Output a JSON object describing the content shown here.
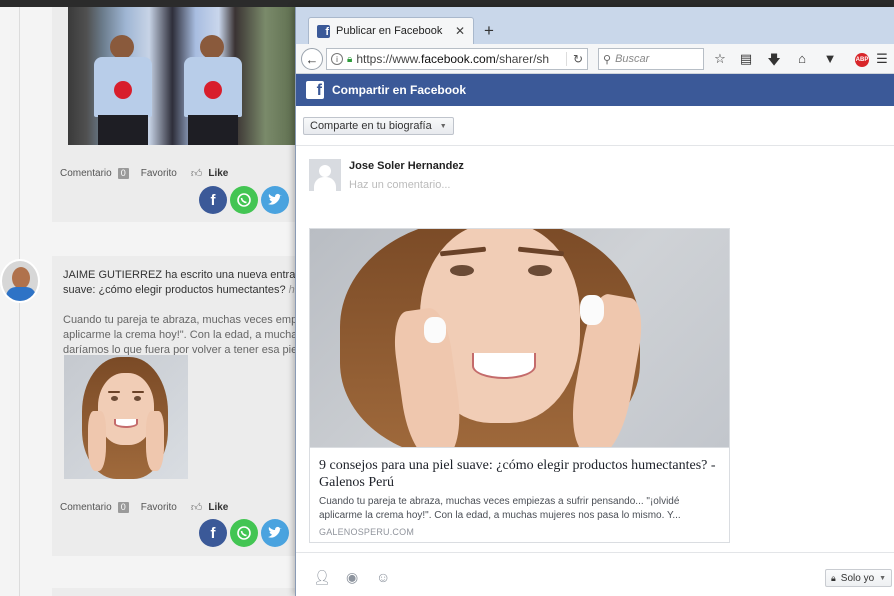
{
  "background_page": {
    "post1": {
      "comment_label": "Comentario",
      "comment_count": "0",
      "favorite_label": "Favorito",
      "like_label": "Like"
    },
    "post2": {
      "author": "JAIME GUTIERREZ",
      "action_text": " ha escrito una nueva entrada,",
      "title_line": "suave: ¿cómo elegir productos humectantes?",
      "time_fragment": "ha",
      "excerpt_lines": [
        "Cuando tu pareja te abraza, muchas veces empi",
        "aplicarme la crema hoy!\". Con la edad, a muchas",
        "daríamos lo que fuera por volver a tener esa pie"
      ],
      "comment_label": "Comentario",
      "comment_count": "0",
      "favorite_label": "Favorito",
      "like_label": "Like"
    },
    "share_icons": [
      "f",
      "whatsapp-icon",
      "twitter-icon"
    ]
  },
  "browser": {
    "tab_title": "Publicar en Facebook",
    "url_prefix": "https://www.",
    "url_domain": "facebook.com",
    "url_path": "/sharer/sh",
    "search_placeholder": "Buscar"
  },
  "facebook_dialog": {
    "header_title": "Compartir en Facebook",
    "share_destination": "Comparte en tu biografía",
    "user_name": "Jose Soler Hernandez",
    "comment_placeholder": "Haz un comentario...",
    "link_preview": {
      "title": "9 consejos para una piel suave: ¿cómo elegir productos humectantes? - Galenos Perú",
      "description": "Cuando tu pareja te abraza, muchas veces empiezas a sufrir pensando... \"¡olvidé aplicarme la crema hoy!\". Con la edad, a muchas mujeres nos pasa lo mismo. Y...",
      "domain": "GALENOSPERU.COM"
    },
    "audience_label": "Solo yo"
  },
  "colors": {
    "facebook_blue": "#3b5998",
    "whatsapp_green": "#43c553",
    "twitter_blue": "#4aa3df",
    "tabstrip": "#c9d7ea"
  }
}
